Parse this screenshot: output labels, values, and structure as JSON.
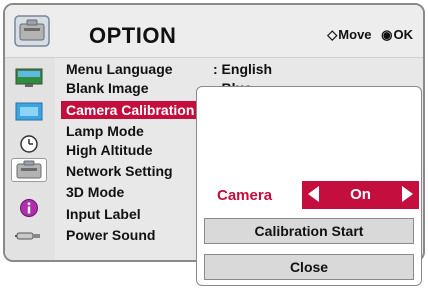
{
  "header": {
    "title": "OPTION",
    "move_hint": "Move",
    "ok_hint": "OK",
    "move_symbol": "◇",
    "ok_symbol": "◉"
  },
  "menu": {
    "items": [
      {
        "label": "Menu Language",
        "value": ": English"
      },
      {
        "label": "Blank Image",
        "value": ": Blue"
      },
      {
        "label": "Camera Calibration",
        "value": ""
      },
      {
        "label": "Lamp Mode",
        "value": ""
      },
      {
        "label": "High Altitude",
        "value": ""
      },
      {
        "label": "Network Setting",
        "value": ""
      },
      {
        "label": "3D Mode",
        "value": ""
      },
      {
        "label": "Input Label",
        "value": ""
      },
      {
        "label": "Power Sound",
        "value": ""
      }
    ]
  },
  "sidebar": {
    "icons": [
      "picture-icon",
      "screen-icon",
      "time-icon",
      "option-icon",
      "info-icon",
      "input-icon"
    ]
  },
  "popup": {
    "camera_label": "Camera",
    "camera_value": "On",
    "calibration_button": "Calibration Start",
    "close_button": "Close"
  },
  "colors": {
    "accent": "#c40e3d",
    "panel": "#e8e8e8",
    "popup": "#ffffff"
  }
}
